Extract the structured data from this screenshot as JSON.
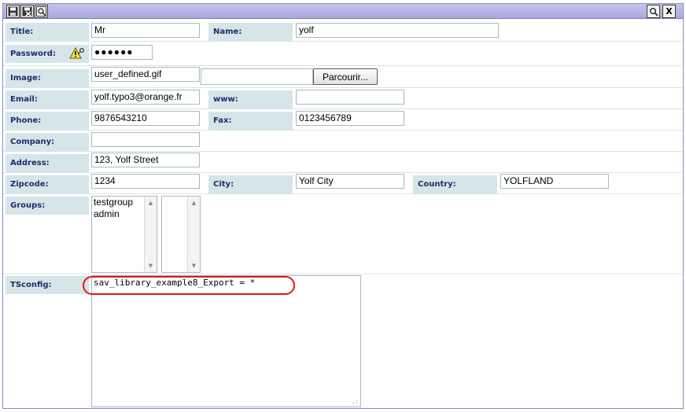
{
  "toolbar": {
    "save_icon": "save-icon",
    "save_close_icon": "save-close-icon",
    "preview_icon": "preview-icon",
    "zoom_icon": "magnifier-icon",
    "close_label": "X"
  },
  "fields": {
    "title": {
      "label": "Title:",
      "value": "Mr"
    },
    "name": {
      "label": "Name:",
      "value": "yolf"
    },
    "password": {
      "label": "Password:",
      "value": "●●●●●●",
      "icon": "warning-key-icon"
    },
    "image": {
      "label": "Image:",
      "value": "user_defined.gif",
      "browse_label": "Parcourir..."
    },
    "email": {
      "label": "Email:",
      "value": "yolf.typo3@orange.fr"
    },
    "www": {
      "label": "www:",
      "value": ""
    },
    "phone": {
      "label": "Phone:",
      "value": "9876543210"
    },
    "fax": {
      "label": "Fax:",
      "value": "0123456789"
    },
    "company": {
      "label": "Company:",
      "value": ""
    },
    "address": {
      "label": "Address:",
      "value": "123, Yolf Street"
    },
    "zipcode": {
      "label": "Zipcode:",
      "value": "1234"
    },
    "city": {
      "label": "City:",
      "value": "Yolf City"
    },
    "country": {
      "label": "Country:",
      "value": "YOLFLAND"
    },
    "groups": {
      "label": "Groups:",
      "options": [
        "testgroup",
        "admin"
      ]
    },
    "tsconfig": {
      "label": "TSconfig:",
      "value": "sav_library_example8_Export = *"
    }
  },
  "colors": {
    "label_bg": "#d6e5e8",
    "label_text": "#1f2c6a",
    "titlebar": "#b4b4e4",
    "highlight": "#e0151b"
  }
}
